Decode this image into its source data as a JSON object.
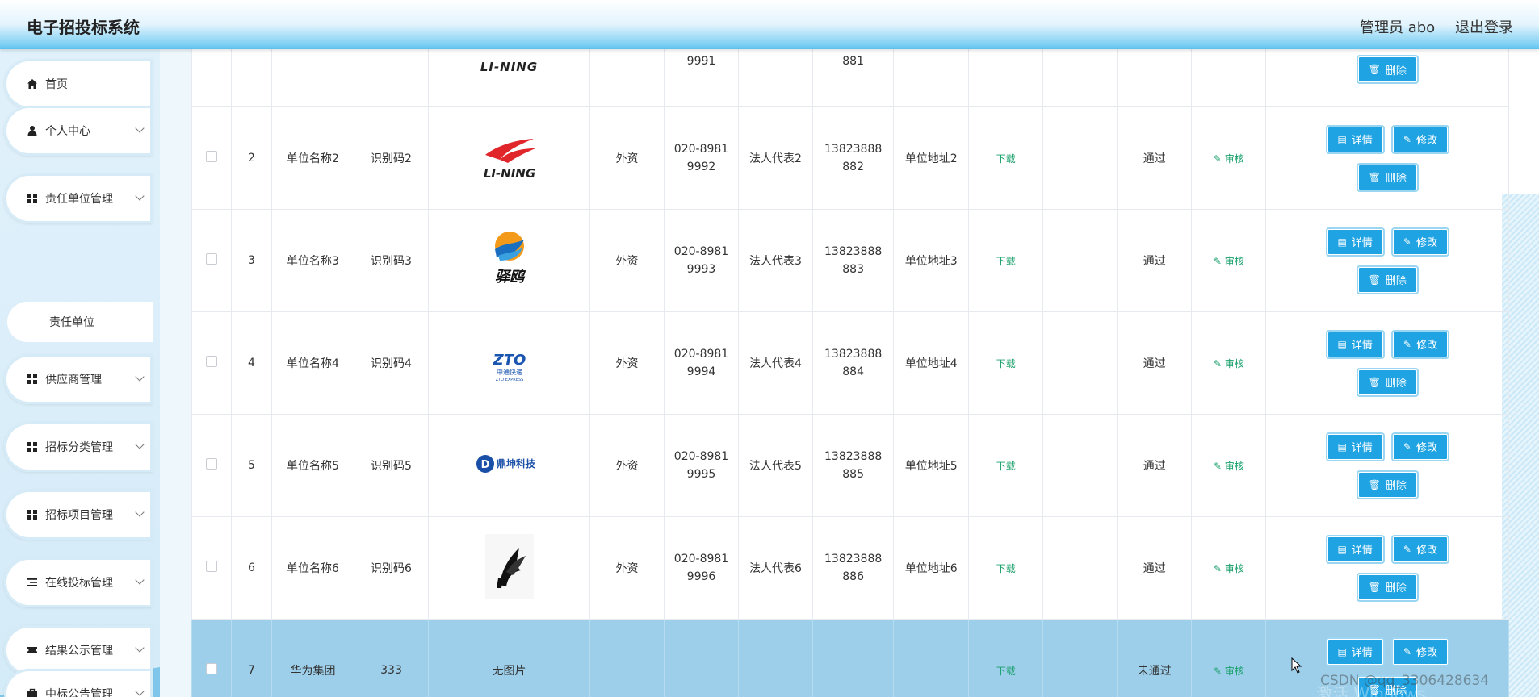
{
  "header": {
    "title": "电子招投标系统",
    "admin": "管理员 abo",
    "logout": "退出登录"
  },
  "sidebar": {
    "items": [
      {
        "label": "首页",
        "icon": "home-icon"
      },
      {
        "label": "个人中心",
        "icon": "user-icon"
      },
      {
        "label": "责任单位管理",
        "icon": "grid-icon"
      },
      {
        "label": "供应商管理",
        "icon": "grid-icon"
      },
      {
        "label": "招标分类管理",
        "icon": "grid-icon"
      },
      {
        "label": "招标项目管理",
        "icon": "grid-icon"
      },
      {
        "label": "在线投标管理",
        "icon": "list-icon"
      },
      {
        "label": "结果公示管理",
        "icon": "ticket-icon"
      },
      {
        "label": "中标公告管理",
        "icon": "briefcase-icon"
      }
    ],
    "submenu": {
      "label": "责任单位"
    }
  },
  "table": {
    "top_partial": {
      "tel": "9991",
      "phone": "881",
      "logo_text": "LI-NING"
    },
    "rows": [
      {
        "index": "2",
        "name": "单位名称2",
        "code": "识别码2",
        "logo": "lining",
        "type": "外资",
        "tel": "020-8981 9992",
        "legal": "法人代表2",
        "phone": "13823888 882",
        "addr": "单位地址2",
        "download": "下载",
        "status": "通过",
        "audit": "审核"
      },
      {
        "index": "3",
        "name": "单位名称3",
        "code": "识别码3",
        "logo": "yiou",
        "type": "外资",
        "tel": "020-8981 9993",
        "legal": "法人代表3",
        "phone": "13823888 883",
        "addr": "单位地址3",
        "download": "下载",
        "status": "通过",
        "audit": "审核"
      },
      {
        "index": "4",
        "name": "单位名称4",
        "code": "识别码4",
        "logo": "zto",
        "type": "外资",
        "tel": "020-8981 9994",
        "legal": "法人代表4",
        "phone": "13823888 884",
        "addr": "单位地址4",
        "download": "下载",
        "status": "通过",
        "audit": "审核"
      },
      {
        "index": "5",
        "name": "单位名称5",
        "code": "识别码5",
        "logo": "dingkun",
        "type": "外资",
        "tel": "020-8981 9995",
        "legal": "法人代表5",
        "phone": "13823888 885",
        "addr": "单位地址5",
        "download": "下载",
        "status": "通过",
        "audit": "审核"
      },
      {
        "index": "6",
        "name": "单位名称6",
        "code": "识别码6",
        "logo": "bird",
        "type": "外资",
        "tel": "020-8981 9996",
        "legal": "法人代表6",
        "phone": "13823888 886",
        "addr": "单位地址6",
        "download": "下载",
        "status": "通过",
        "audit": "审核"
      },
      {
        "index": "7",
        "name": "华为集团",
        "code": "333",
        "logo": "none",
        "no_image": "无图片",
        "type": "",
        "tel": "",
        "legal": "",
        "phone": "",
        "addr": "",
        "download": "下载",
        "status": "未通过",
        "audit": "审核"
      }
    ],
    "buttons": {
      "detail": "详情",
      "edit": "修改",
      "delete": "删除"
    },
    "logo_texts": {
      "lining": "LI-NING",
      "yiou": "驿鸥",
      "zto": "ZTO",
      "zto_cn": "中通快递",
      "zto_en": "ZTO EXPRESS",
      "dingkun": "鼎坤科技"
    }
  },
  "watermark": {
    "csdn": "CSDN @qq_3306428634",
    "windows": "激活 Windows"
  },
  "colors": {
    "primary": "#1fa3e3",
    "selected_row": "#9dcfea",
    "link_green": "#1aa06b"
  }
}
